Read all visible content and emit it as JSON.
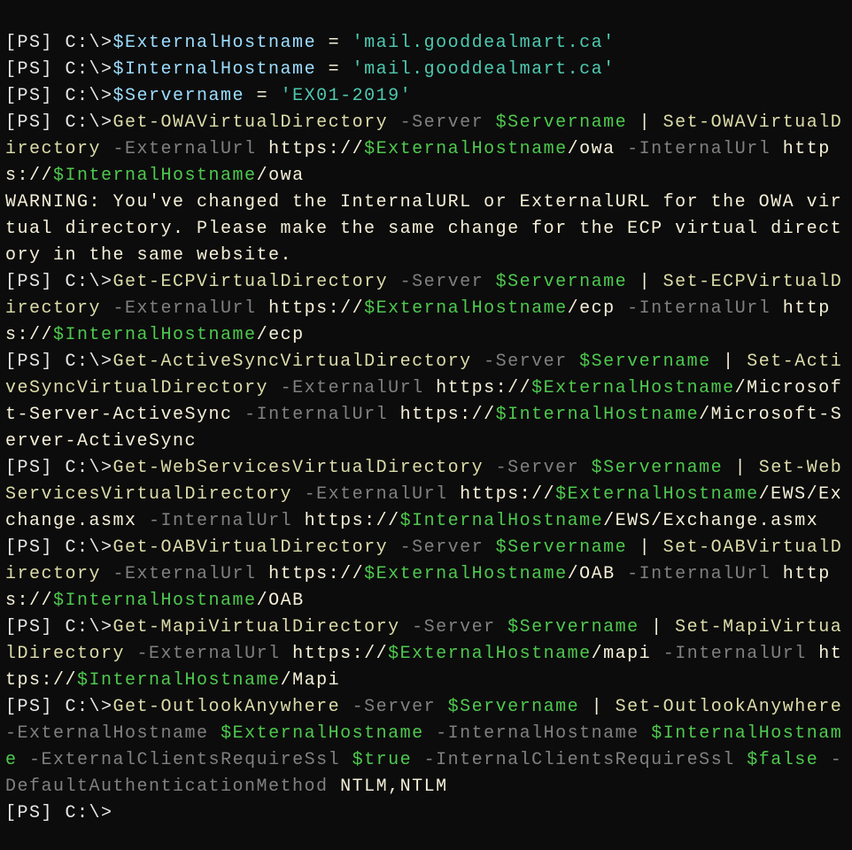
{
  "prompt": "[PS] C:\\>",
  "vars": {
    "externalHostnameVar": "$ExternalHostname",
    "internalHostnameVar": "$InternalHostname",
    "servernameVar": "$Servername",
    "externalHostnameVal": "'mail.gooddealmart.ca'",
    "internalHostnameVal": "'mail.gooddealmart.ca'",
    "servernameVal": "'EX01-2019'"
  },
  "cmds": {
    "getOwa": "Get-OWAVirtualDirectory",
    "setOwa": "Set-OWAVirtualDirectory",
    "getEcp": "Get-ECPVirtualDirectory",
    "setEcp": "Set-ECPVirtualDirectory",
    "getAS": "Get-ActiveSyncVirtualDirectory",
    "setAS": "Set-ActiveSyncVirtualDirectory",
    "getWS": "Get-WebServicesVirtualDirectory",
    "setWS": "Set-WebServicesVirtualDirectory",
    "getOab": "Get-OABVirtualDirectory",
    "setOab": "Set-OABVirtualDirectory",
    "getMapi": "Get-MapiVirtualDirectory",
    "setMapi": "Set-MapiVirtualDirectory",
    "getOA": "Get-OutlookAnywhere",
    "setOA": "Set-OutlookAnywhere"
  },
  "params": {
    "server": "-Server",
    "externalUrl": "-ExternalUrl",
    "internalUrl": "-InternalUrl",
    "externalHostname": "-ExternalHostname",
    "internalHostname": "-InternalHostname",
    "externalClientsRequireSsl": "-ExternalClientsRequireSsl",
    "internalClientsRequireSsl": "-InternalClientsRequireSsl",
    "defaultAuthMethod": "-DefaultAuthenticationMethod"
  },
  "paths": {
    "owa": "/owa",
    "ecp": "/ecp",
    "as": "/Microsoft-Server-ActiveSync",
    "ews": "/EWS/Exchange.asmx",
    "oab": "/OAB",
    "mapi": "/mapi",
    "mapiCap": "/Mapi"
  },
  "literals": {
    "eq": " = ",
    "pipe": " | ",
    "https": "https://",
    "space": " ",
    "true": "$true",
    "false": "$false",
    "ntlm": "NTLM,NTLM"
  },
  "warning": "WARNING: You've changed the InternalURL or ExternalURL for the OWA virtual directory. Please make the same change for the ECP virtual directory in the same website."
}
